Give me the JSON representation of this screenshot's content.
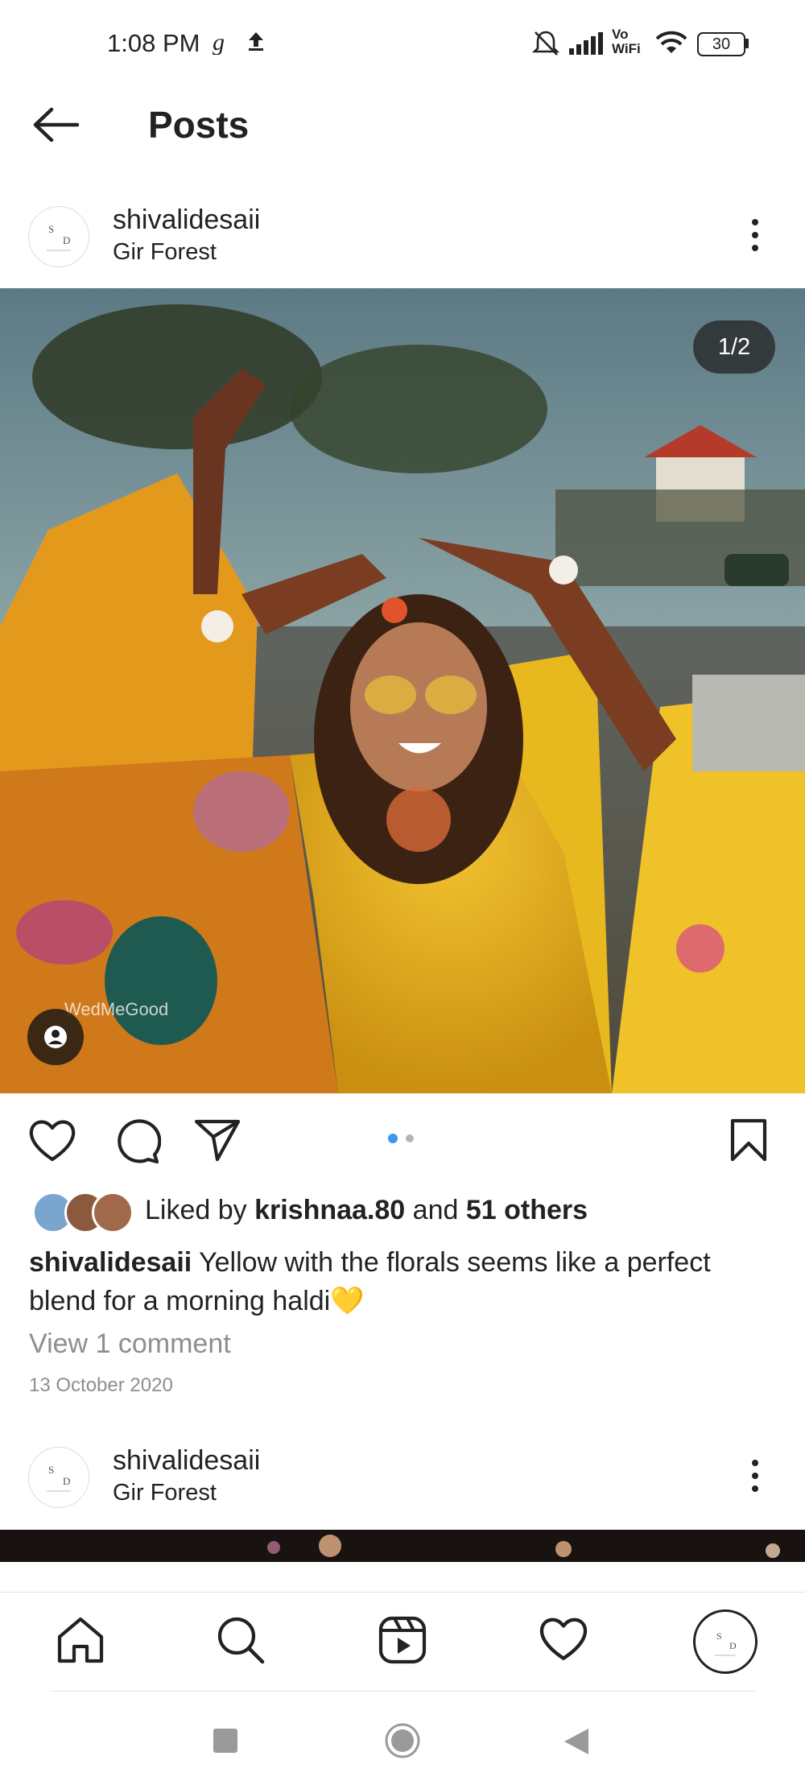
{
  "status_bar": {
    "time": "1:08 PM",
    "battery": "30",
    "network_label": "Vo WiFi"
  },
  "header": {
    "title": "Posts"
  },
  "post": {
    "username": "shivalidesaii",
    "location": "Gir Forest",
    "avatar_initials": "S D",
    "image_counter": "1/2",
    "watermark": "WedMeGood",
    "likes_prefix": "Liked by ",
    "likes_user": "krishnaa.80",
    "likes_and": " and ",
    "likes_others": "51 others",
    "caption_user": "shivalidesaii",
    "caption_text": " Yellow with the florals seems like a perfect blend for a morning haldi",
    "caption_emoji": "💛",
    "view_comments": "View 1 comment",
    "date": "13 October 2020",
    "carousel": {
      "count": 2,
      "active": 1
    }
  },
  "next_post": {
    "username": "shivalidesaii",
    "location": "Gir Forest",
    "avatar_initials": "S D"
  },
  "bottom_nav": {
    "items": [
      "home-icon",
      "search-icon",
      "reels-icon",
      "activity-heart-icon",
      "profile-avatar"
    ]
  },
  "colors": {
    "accent_blue": "#3897f0",
    "muted_grey": "#8e8e8e",
    "text": "#222222"
  }
}
